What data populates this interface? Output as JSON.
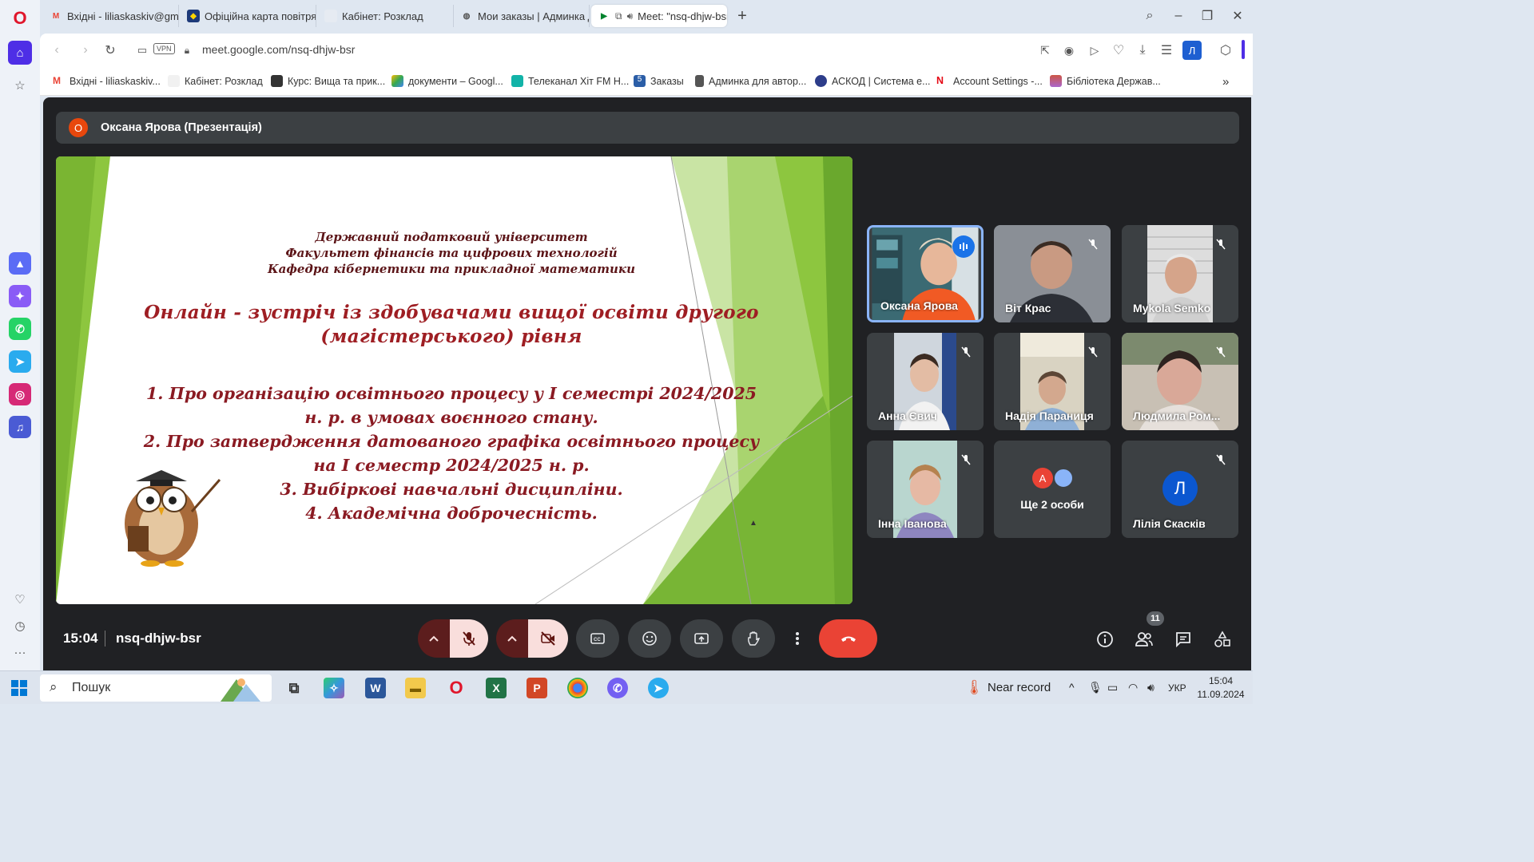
{
  "browser": {
    "tabs": [
      {
        "label": "Вхідні - liliaskaskiv@gmail",
        "icon": "gmail-icon"
      },
      {
        "label": "Офіційна карта повітряних",
        "icon": "shield-icon"
      },
      {
        "label": "Кабінет: Розклад",
        "icon": "page-icon"
      },
      {
        "label": "Мои заказы | Админка для",
        "icon": "globe-icon"
      },
      {
        "label": "Meet: \"nsq-dhjw-bsr\"",
        "icon": "meet-icon",
        "active": true
      }
    ],
    "url": "meet.google.com/nsq-dhjw-bsr",
    "vpn_label": "VPN",
    "profile_initial": "Л",
    "bookmarks": [
      "Вхідні - liliaskaskiv...",
      "Кабінет: Розклад",
      "Курс: Вища та прик...",
      "документи – Googl...",
      "Телеканал Хіт FM Н...",
      "Заказы",
      "Админка для автор...",
      "АСКОД | Система е...",
      "Account Settings -...",
      "Бібліотека Держав..."
    ]
  },
  "meet": {
    "presenter_initial": "О",
    "presenter_label": "Оксана Ярова (Презентація)",
    "slide": {
      "header_lines": [
        "Державний податковий університет",
        "Факультет фінансів та цифрових технологій",
        "Кафедра кібернетики та прикладної математики"
      ],
      "title_lines": [
        "Онлайн - зустріч із здобувачами вищої освіти другого",
        "(магістерського) рівня"
      ],
      "items": [
        "1. Про організацію освітнього процесу у І семестрі 2024/2025",
        "н. р. в умовах воєнного стану.",
        "2. Про затвердження датованого графіка освітнього процесу",
        "на І семестр 2024/2025 н. р.",
        "3. Вибіркові навчальні дисципліни.",
        "4. Академічна доброчесність."
      ]
    },
    "participants": [
      {
        "name": "Оксана Ярова",
        "speaking": true
      },
      {
        "name": "Віт Крас",
        "muted": true
      },
      {
        "name": "Mykola Semko",
        "muted": true
      },
      {
        "name": "Анна Євич",
        "muted": true
      },
      {
        "name": "Надія Параниця",
        "muted": true
      },
      {
        "name": "Людмила Ром...",
        "muted": true
      },
      {
        "name": "Інна Іванова",
        "muted": true
      },
      {
        "name": "Ще 2 особи",
        "avatar": "А"
      },
      {
        "name": "Лілія Скаскiв",
        "muted": true,
        "avatar": "Л"
      }
    ],
    "time": "15:04",
    "meeting_code": "nsq-dhjw-bsr",
    "people_count": "11"
  },
  "taskbar": {
    "search_placeholder": "Пошук",
    "weather_label": "Near record",
    "language": "УКР",
    "time": "15:04",
    "date": "11.09.2024"
  },
  "colors": {
    "meet_bg": "#202124",
    "leave_red": "#ea4335",
    "muted_red": "#f9dedc",
    "slide_green": "#8dc63f",
    "slide_text": "#8a1a22"
  }
}
